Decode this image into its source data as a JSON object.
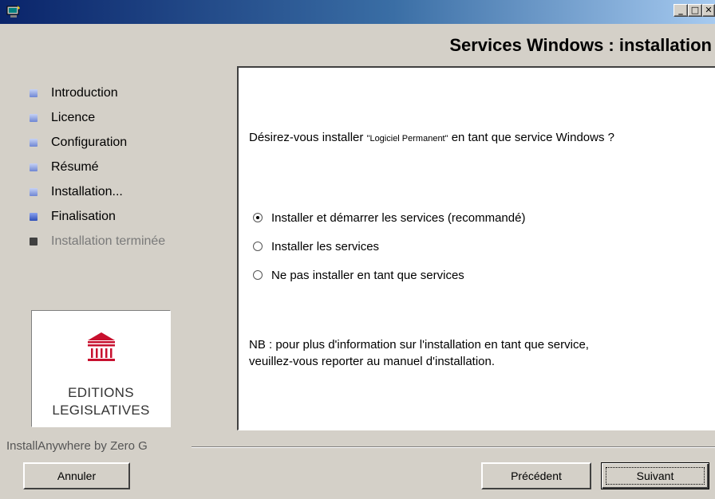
{
  "window": {
    "controls": {
      "minimize": "_",
      "maximize": "□",
      "close": "✕"
    },
    "icon": "installer-app-icon"
  },
  "header": {
    "title": "Services Windows : installation"
  },
  "steps": [
    {
      "label": "Introduction",
      "state": "done"
    },
    {
      "label": "Licence",
      "state": "done"
    },
    {
      "label": "Configuration",
      "state": "done"
    },
    {
      "label": "Résumé",
      "state": "done"
    },
    {
      "label": "Installation...",
      "state": "done"
    },
    {
      "label": "Finalisation",
      "state": "current"
    },
    {
      "label": "Installation terminée",
      "state": "pending"
    }
  ],
  "logo": {
    "line1": "EDITIONS",
    "line2": "LEGISLATIVES",
    "icon": "temple-icon",
    "color": "#c8102e"
  },
  "content": {
    "question_prefix": "Désirez-vous installer ",
    "question_product": "\"Logiciel Permanent\"",
    "question_suffix": " en tant que service Windows ?",
    "options": [
      {
        "label": "Installer et démarrer les services (recommandé)",
        "checked": true
      },
      {
        "label": "Installer les services",
        "checked": false
      },
      {
        "label": "Ne pas installer en tant que services",
        "checked": false
      }
    ],
    "note_line1": "NB : pour plus d'information sur l'installation en tant que service,",
    "note_line2": "veuillez-vous reporter au manuel d'installation."
  },
  "footer": {
    "branding": "InstallAnywhere by Zero G",
    "cancel_label": "Annuler",
    "previous_label": "Précédent",
    "next_label": "Suivant"
  },
  "colors": {
    "titlebar_start": "#0a246a",
    "titlebar_end": "#a6caf0",
    "dialog": "#d4d0c8",
    "bullet": "#5873c9"
  }
}
